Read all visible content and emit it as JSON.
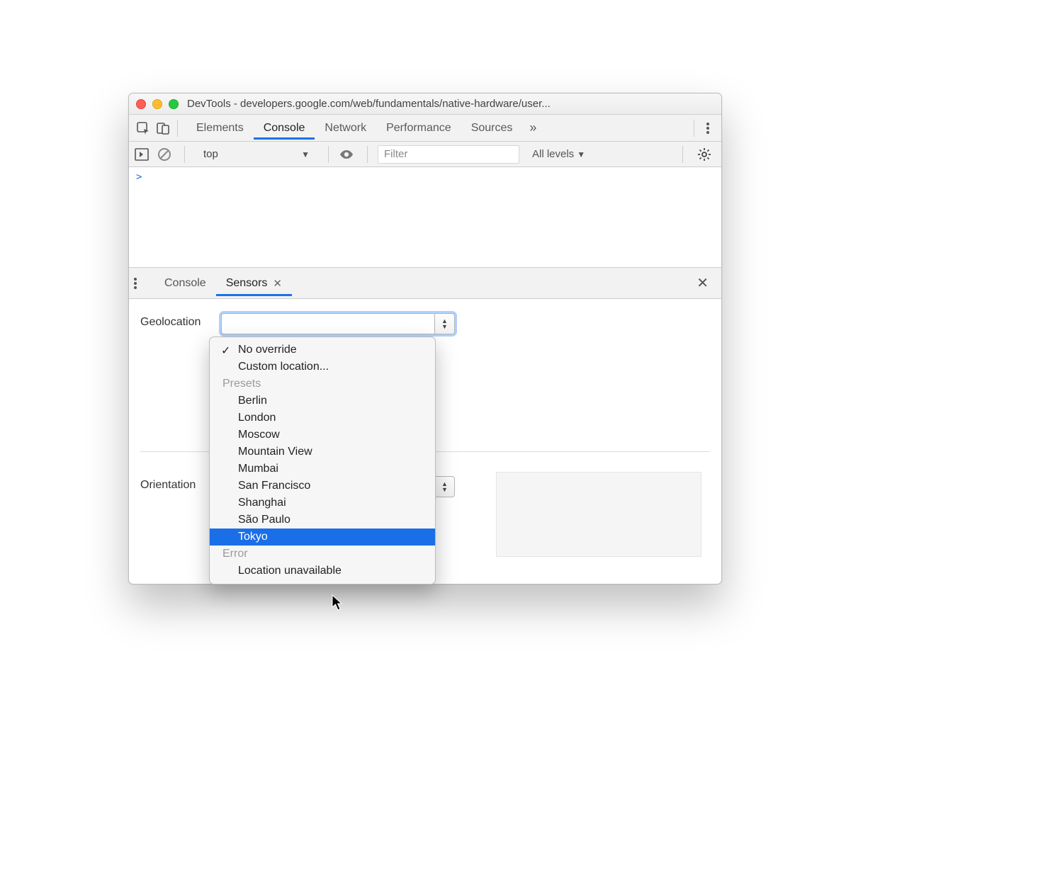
{
  "window": {
    "title": "DevTools - developers.google.com/web/fundamentals/native-hardware/user..."
  },
  "mainTabs": {
    "items": [
      "Elements",
      "Console",
      "Network",
      "Performance",
      "Sources"
    ],
    "activeIndex": 1
  },
  "consoleBar": {
    "context": "top",
    "filterPlaceholder": "Filter",
    "levels": "All levels"
  },
  "console": {
    "prompt": ">"
  },
  "drawer": {
    "tabs": [
      "Console",
      "Sensors"
    ],
    "activeIndex": 1
  },
  "sensors": {
    "geolocationLabel": "Geolocation",
    "orientationLabel": "Orientation"
  },
  "geoDropdown": {
    "topItems": [
      {
        "label": "No override",
        "checked": true
      },
      {
        "label": "Custom location...",
        "checked": false
      }
    ],
    "presetsHeader": "Presets",
    "presets": [
      "Berlin",
      "London",
      "Moscow",
      "Mountain View",
      "Mumbai",
      "San Francisco",
      "Shanghai",
      "São Paulo",
      "Tokyo"
    ],
    "highlighted": "Tokyo",
    "errorHeader": "Error",
    "errorItems": [
      "Location unavailable"
    ]
  }
}
